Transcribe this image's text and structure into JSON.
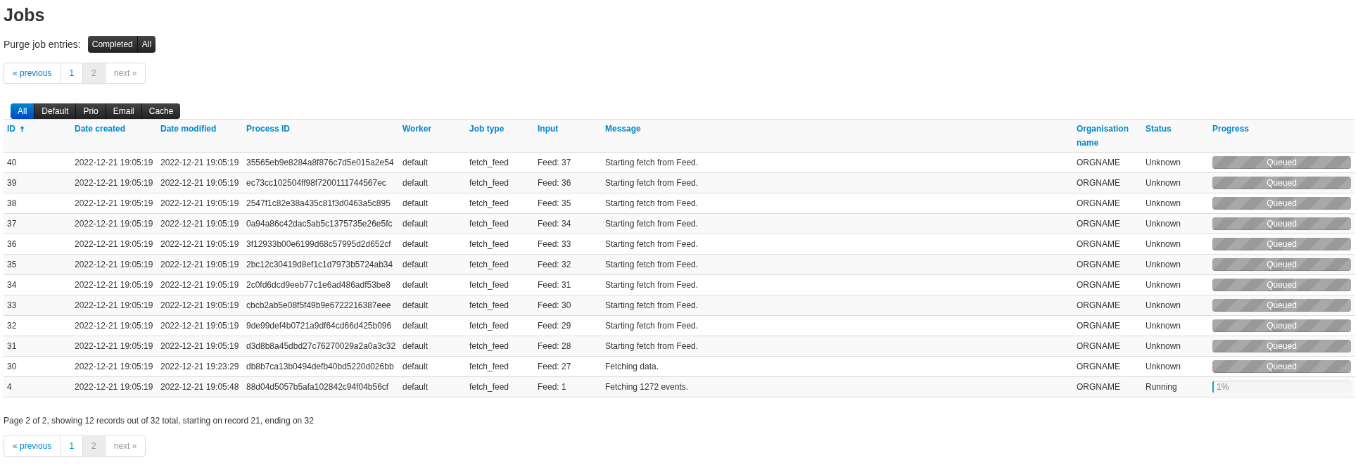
{
  "title": "Jobs",
  "purge": {
    "label": "Purge job entries:",
    "buttons": [
      "Completed",
      "All"
    ]
  },
  "pagination_top": [
    {
      "label": "« previous",
      "selected": false,
      "disabled": false
    },
    {
      "label": "1",
      "selected": false,
      "disabled": false
    },
    {
      "label": "2",
      "selected": true,
      "disabled": false
    },
    {
      "label": "next »",
      "selected": false,
      "disabled": true
    }
  ],
  "queue_tabs": [
    {
      "label": "All",
      "selected": true
    },
    {
      "label": "Default",
      "selected": false
    },
    {
      "label": "Prio",
      "selected": false
    },
    {
      "label": "Email",
      "selected": false
    },
    {
      "label": "Cache",
      "selected": false
    }
  ],
  "table": {
    "columns": [
      {
        "label": "ID",
        "sorted": true
      },
      {
        "label": "Date created",
        "sorted": false
      },
      {
        "label": "Date modified",
        "sorted": false
      },
      {
        "label": "Process ID",
        "sorted": false
      },
      {
        "label": "Worker",
        "sorted": false
      },
      {
        "label": "Job type",
        "sorted": false
      },
      {
        "label": "Input",
        "sorted": false
      },
      {
        "label": "Message",
        "sorted": false
      },
      {
        "label": "Organisation name",
        "sorted": false
      },
      {
        "label": "Status",
        "sorted": false
      },
      {
        "label": "Progress",
        "sorted": false
      }
    ],
    "rows": [
      {
        "id": "40",
        "created": "2022-12-21 19:05:19",
        "modified": "2022-12-21 19:05:19",
        "process_id": "35565eb9e8284a8f876c7d5e015a2e54",
        "worker": "default",
        "job_type": "fetch_feed",
        "input": "Feed: 37",
        "message": "Starting fetch from Feed.",
        "org": "ORGNAME",
        "status": "Unknown",
        "progress": {
          "kind": "queued",
          "level": 1,
          "text": "Queued"
        }
      },
      {
        "id": "39",
        "created": "2022-12-21 19:05:19",
        "modified": "2022-12-21 19:05:19",
        "process_id": "ec73cc102504ff98f7200111744567ec",
        "worker": "default",
        "job_type": "fetch_feed",
        "input": "Feed: 36",
        "message": "Starting fetch from Feed.",
        "org": "ORGNAME",
        "status": "Unknown",
        "progress": {
          "kind": "queued",
          "level": 1,
          "text": "Queued"
        }
      },
      {
        "id": "38",
        "created": "2022-12-21 19:05:19",
        "modified": "2022-12-21 19:05:19",
        "process_id": "2547f1c82e38a435c81f3d0463a5c895",
        "worker": "default",
        "job_type": "fetch_feed",
        "input": "Feed: 35",
        "message": "Starting fetch from Feed.",
        "org": "ORGNAME",
        "status": "Unknown",
        "progress": {
          "kind": "queued",
          "level": 1,
          "text": "Queued"
        }
      },
      {
        "id": "37",
        "created": "2022-12-21 19:05:19",
        "modified": "2022-12-21 19:05:19",
        "process_id": "0a94a86c42dac5ab5c1375735e26e5fc",
        "worker": "default",
        "job_type": "fetch_feed",
        "input": "Feed: 34",
        "message": "Starting fetch from Feed.",
        "org": "ORGNAME",
        "status": "Unknown",
        "progress": {
          "kind": "queued",
          "level": 1,
          "text": "Queued"
        }
      },
      {
        "id": "36",
        "created": "2022-12-21 19:05:19",
        "modified": "2022-12-21 19:05:19",
        "process_id": "3f12933b00e6199d68c57995d2d652cf",
        "worker": "default",
        "job_type": "fetch_feed",
        "input": "Feed: 33",
        "message": "Starting fetch from Feed.",
        "org": "ORGNAME",
        "status": "Unknown",
        "progress": {
          "kind": "queued",
          "level": 1,
          "text": "Queued"
        }
      },
      {
        "id": "35",
        "created": "2022-12-21 19:05:19",
        "modified": "2022-12-21 19:05:19",
        "process_id": "2bc12c30419d8ef1c1d7973b5724ab34",
        "worker": "default",
        "job_type": "fetch_feed",
        "input": "Feed: 32",
        "message": "Starting fetch from Feed.",
        "org": "ORGNAME",
        "status": "Unknown",
        "progress": {
          "kind": "queued",
          "level": 1,
          "text": "Queued"
        }
      },
      {
        "id": "34",
        "created": "2022-12-21 19:05:19",
        "modified": "2022-12-21 19:05:19",
        "process_id": "2c0fd6dcd9eeb77c1e6ad486adf53be8",
        "worker": "default",
        "job_type": "fetch_feed",
        "input": "Feed: 31",
        "message": "Starting fetch from Feed.",
        "org": "ORGNAME",
        "status": "Unknown",
        "progress": {
          "kind": "queued",
          "level": 1,
          "text": "Queued"
        }
      },
      {
        "id": "33",
        "created": "2022-12-21 19:05:19",
        "modified": "2022-12-21 19:05:19",
        "process_id": "cbcb2ab5e08f5f49b9e6722216387eee",
        "worker": "default",
        "job_type": "fetch_feed",
        "input": "Feed: 30",
        "message": "Starting fetch from Feed.",
        "org": "ORGNAME",
        "status": "Unknown",
        "progress": {
          "kind": "queued",
          "level": 1,
          "text": "Queued"
        }
      },
      {
        "id": "32",
        "created": "2022-12-21 19:05:19",
        "modified": "2022-12-21 19:05:19",
        "process_id": "9de99def4b0721a9df64cd66d425b096",
        "worker": "default",
        "job_type": "fetch_feed",
        "input": "Feed: 29",
        "message": "Starting fetch from Feed.",
        "org": "ORGNAME",
        "status": "Unknown",
        "progress": {
          "kind": "queued",
          "level": 1,
          "text": "Queued"
        }
      },
      {
        "id": "31",
        "created": "2022-12-21 19:05:19",
        "modified": "2022-12-21 19:05:19",
        "process_id": "d3d8b8a45dbd27c76270029a2a0a3c32",
        "worker": "default",
        "job_type": "fetch_feed",
        "input": "Feed: 28",
        "message": "Starting fetch from Feed.",
        "org": "ORGNAME",
        "status": "Unknown",
        "progress": {
          "kind": "queued",
          "level": 1,
          "text": "Queued"
        }
      },
      {
        "id": "30",
        "created": "2022-12-21 19:05:19",
        "modified": "2022-12-21 19:23:29",
        "process_id": "db8b7ca13b0494defb40bd5220d026bb",
        "worker": "default",
        "job_type": "fetch_feed",
        "input": "Feed: 27",
        "message": "Fetching data.",
        "org": "ORGNAME",
        "status": "Unknown",
        "progress": {
          "kind": "queued",
          "level": 1,
          "text": "Queued"
        }
      },
      {
        "id": "4",
        "created": "2022-12-21 19:05:19",
        "modified": "2022-12-21 19:05:48",
        "process_id": "88d04d5057b5afa102842c94f04b56cf",
        "worker": "default",
        "job_type": "fetch_feed",
        "input": "Feed: 1",
        "message": "Fetching 1272 events.",
        "org": "ORGNAME",
        "status": "Running",
        "progress": {
          "kind": "bar",
          "level": 0.01,
          "text": "1%"
        }
      }
    ]
  },
  "summary": "Page 2 of 2, showing 12 records out of 32 total, starting on record 21, ending on 32",
  "pagination_bottom": [
    {
      "label": "« previous",
      "selected": false,
      "disabled": false
    },
    {
      "label": "1",
      "selected": false,
      "disabled": false
    },
    {
      "label": "2",
      "selected": true,
      "disabled": false
    },
    {
      "label": "next »",
      "selected": false,
      "disabled": true
    }
  ]
}
